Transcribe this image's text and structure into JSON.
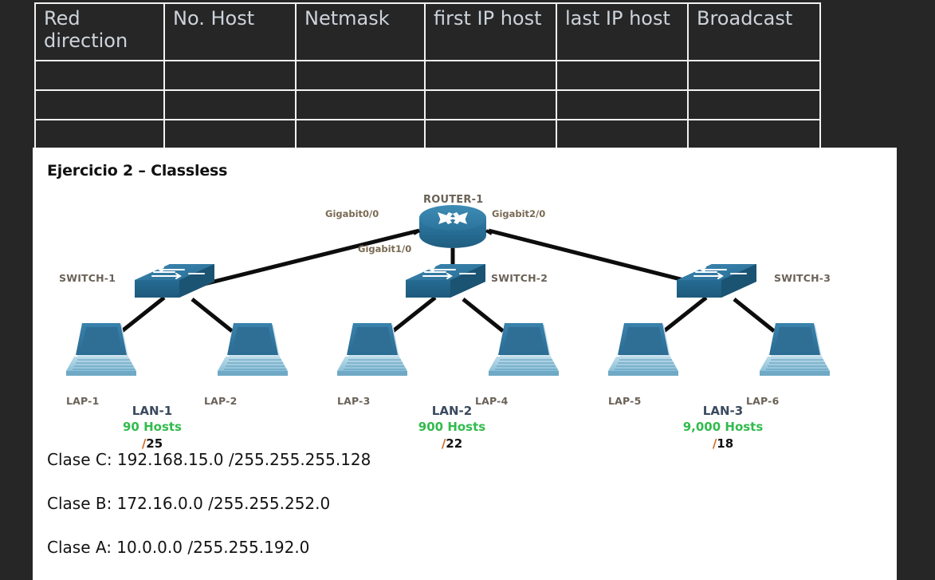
{
  "table": {
    "headers": [
      "Red direction",
      "No. Host",
      "Netmask",
      "first IP host",
      "last IP host",
      "Broadcast"
    ],
    "rows": [
      [
        "",
        "",
        "",
        "",
        "",
        ""
      ],
      [
        "",
        "",
        "",
        "",
        "",
        ""
      ],
      [
        "",
        "",
        "",
        "",
        "",
        ""
      ]
    ]
  },
  "slide": {
    "title": "Ejercicio 2 – Classless",
    "router": {
      "name": "ROUTER-1",
      "interfaces": {
        "left": "Gigabit0/0",
        "center": "Gigabit1/0",
        "right": "Gigabit2/0"
      }
    },
    "switches": [
      {
        "name": "SWITCH-1"
      },
      {
        "name": "SWITCH-2"
      },
      {
        "name": "SWITCH-3"
      }
    ],
    "laptops": [
      {
        "name": "LAP-1"
      },
      {
        "name": "LAP-2"
      },
      {
        "name": "LAP-3"
      },
      {
        "name": "LAP-4"
      },
      {
        "name": "LAP-5"
      },
      {
        "name": "LAP-6"
      }
    ],
    "lans": [
      {
        "name": "LAN-1",
        "hosts": "90 Hosts",
        "slash": "/",
        "cidr": "25"
      },
      {
        "name": "LAN-2",
        "hosts": "900 Hosts",
        "slash": "/",
        "cidr": "22"
      },
      {
        "name": "LAN-3",
        "hosts": "9,000 Hosts",
        "slash": "/",
        "cidr": "18"
      }
    ],
    "class_lines": [
      "Clase C: 192.168.15.0 /255.255.255.128",
      "Clase B: 172.16.0.0 /255.255.252.0",
      "Clase A: 10.0.0.0 /255.255.192.0"
    ]
  },
  "colors": {
    "background": "#262626",
    "panel": "#ffffff",
    "device_blue": "#2e7ba6",
    "device_blue_dark": "#1f5d80",
    "device_blue_light": "#7fb4d0",
    "hosts_green": "#32bb4e",
    "lan_navy": "#3a4a5e",
    "label_brown": "#6b6258",
    "slash_orange": "#d2691e",
    "table_border": "#f2f2f2",
    "table_text": "#ccd3da"
  }
}
